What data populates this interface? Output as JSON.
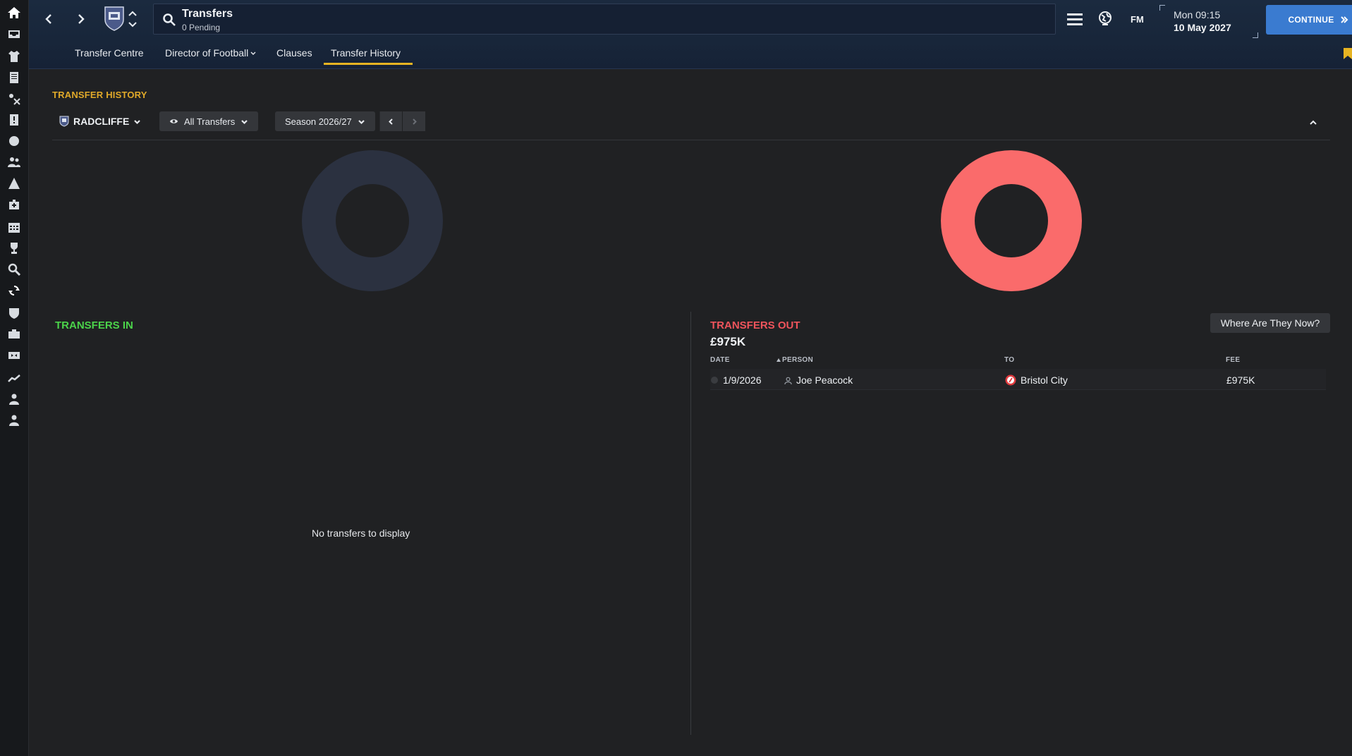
{
  "header": {
    "page_title": "Transfers",
    "page_subtitle": "0 Pending",
    "fm_label": "FM",
    "time": "Mon 09:15",
    "date": "10 May 2027",
    "continue_label": "CONTINUE"
  },
  "tabs": [
    {
      "label": "Transfer Centre"
    },
    {
      "label": "Director of Football"
    },
    {
      "label": "Clauses"
    },
    {
      "label": "Transfer History"
    }
  ],
  "sidebar": {
    "icons": [
      "home-icon",
      "inbox-icon",
      "squad-icon",
      "notes-icon",
      "tactics-icon",
      "report-icon",
      "training-icon",
      "staff-icon",
      "development-icon",
      "medical-icon",
      "schedule-icon",
      "competitions-icon",
      "scouting-icon",
      "transfers-icon",
      "club-icon",
      "finances-icon",
      "dof-icon",
      "analytics-icon",
      "manager-icon",
      "profile-icon"
    ]
  },
  "history": {
    "section_title": "TRANSFER HISTORY",
    "club_name": "RADCLIFFE",
    "filter_label": "All Transfers",
    "season_label": "Season 2026/27"
  },
  "transfers_in": {
    "title": "TRANSFERS IN",
    "empty_message": "No transfers to display"
  },
  "transfers_out": {
    "title": "TRANSFERS OUT",
    "total": "£975K",
    "where_button": "Where Are They Now?",
    "columns": {
      "date": "DATE",
      "person": "PERSON",
      "to": "TO",
      "fee": "FEE"
    },
    "rows": [
      {
        "date": "1/9/2026",
        "person": "Joe Peacock",
        "to": "Bristol City",
        "fee": "£975K"
      }
    ]
  },
  "colors": {
    "accent": "#e7b422",
    "in_color": "#4bd34a",
    "out_color": "#f0545c",
    "donut_out": "#fa6b6b",
    "donut_empty": "#2b3140",
    "continue": "#3a7bd0"
  }
}
